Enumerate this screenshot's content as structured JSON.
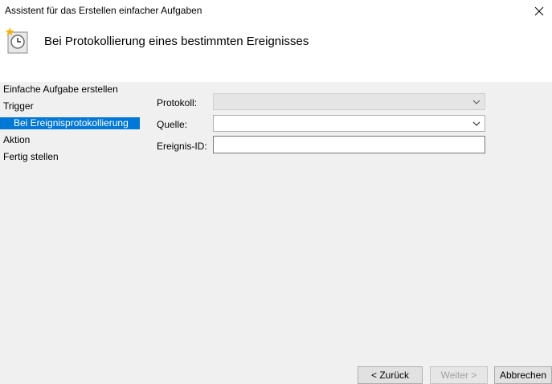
{
  "window": {
    "title": "Assistent für das Erstellen einfacher Aufgaben"
  },
  "header": {
    "title": "Bei Protokollierung eines bestimmten Ereignisses",
    "icon": "task-clock-icon"
  },
  "nav": {
    "items": [
      {
        "label": "Einfache Aufgabe erstellen"
      },
      {
        "label": "Trigger"
      },
      {
        "label": "Bei Ereignisprotokollierung",
        "selected": true
      },
      {
        "label": "Aktion"
      },
      {
        "label": "Fertig stellen"
      }
    ]
  },
  "form": {
    "protokoll_label": "Protokoll:",
    "protokoll_value": "",
    "quelle_label": "Quelle:",
    "quelle_value": "",
    "ereignis_id_label": "Ereignis-ID:",
    "ereignis_id_value": ""
  },
  "buttons": {
    "back": "< Zurück",
    "next": "Weiter >",
    "cancel": "Abbrechen"
  },
  "colors": {
    "selection": "#0078d7",
    "background": "#f0f0f0"
  }
}
